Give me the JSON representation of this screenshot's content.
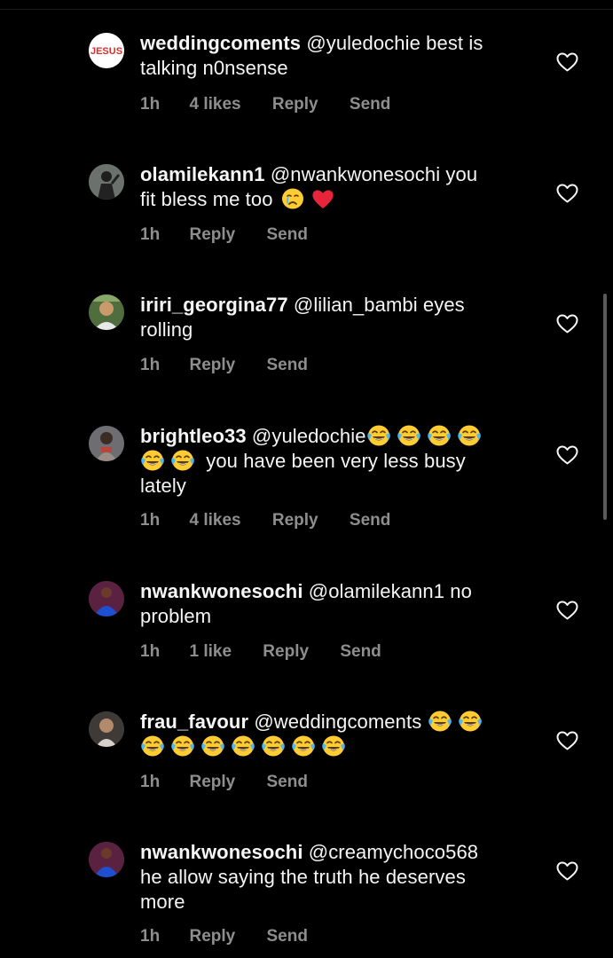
{
  "comments": [
    {
      "username": "weddingcoments",
      "text_lines": [
        "@yuledochie best is",
        "talking n0nsense"
      ],
      "time": "1h",
      "likes": "4 likes",
      "reply": "Reply",
      "send": "Send",
      "avatar_label": "JESUS"
    },
    {
      "username": "olamilekann1",
      "text_lines": [
        "@nwankwonesochi you",
        "fit bless me too"
      ],
      "time": "1h",
      "likes": "",
      "reply": "Reply",
      "send": "Send"
    },
    {
      "username": "iriri_georgina77",
      "text_lines": [
        "@lilian_bambi eyes",
        "rolling"
      ],
      "time": "1h",
      "likes": "",
      "reply": "Reply",
      "send": "Send"
    },
    {
      "username": "brightleo33",
      "text_lines": [
        "@yuledochie",
        "you have been very less busy",
        "lately"
      ],
      "time": "1h",
      "likes": "4 likes",
      "reply": "Reply",
      "send": "Send"
    },
    {
      "username": "nwankwonesochi",
      "text_lines": [
        "@olamilekann1 no",
        "problem"
      ],
      "time": "1h",
      "likes": "1 like",
      "reply": "Reply",
      "send": "Send"
    },
    {
      "username": "frau_favour",
      "text_lines": [
        "@weddingcoments"
      ],
      "time": "1h",
      "likes": "",
      "reply": "Reply",
      "send": "Send"
    },
    {
      "username": "nwankwonesochi",
      "text_lines": [
        "@creamychoco568",
        "he allow saying the truth he deserves",
        "more"
      ],
      "time": "1h",
      "likes": "",
      "reply": "Reply",
      "send": "Send"
    }
  ],
  "icons": {
    "like": "heart-outline-icon",
    "crying": "crying-face-emoji",
    "heart_emoji": "red-heart-emoji",
    "laughing": "tears-of-joy-emoji"
  },
  "colors": {
    "background": "#000000",
    "text": "#f5f5f5",
    "meta": "#8e8e8e",
    "jesus_red": "#d32f2f"
  }
}
